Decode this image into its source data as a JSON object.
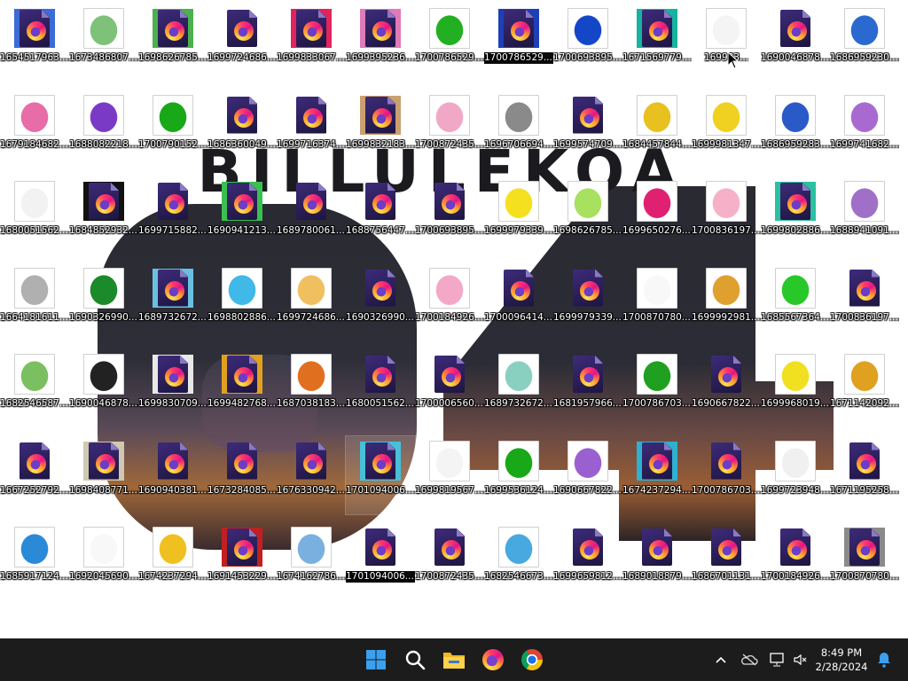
{
  "taskbar": {
    "start_label": "Start",
    "search_label": "Search",
    "pinned": [
      "File Explorer",
      "Firefox",
      "Google Chrome"
    ],
    "clock_time": "8:49 PM",
    "clock_date": "2/28/2024"
  },
  "wallpaper": {
    "title_text": "BILLULEKOA",
    "digits": "64"
  },
  "colors": {
    "taskbar_bg": "#1c1c1c",
    "desktop_bg": "#ffffff",
    "firefox_file": "#3d2b7a"
  },
  "icons": [
    {
      "label": "1654517963....",
      "type": "firefox-file",
      "thumb": "#3b6bd6"
    },
    {
      "label": "1673486807....",
      "type": "image",
      "thumb": "#7ec27a"
    },
    {
      "label": "1698626785....",
      "type": "firefox-file",
      "thumb": "#4caf50"
    },
    {
      "label": "1699724686....",
      "type": "firefox-file"
    },
    {
      "label": "1699833067....",
      "type": "firefox-file",
      "thumb": "#e0245e"
    },
    {
      "label": "1699395236....",
      "type": "firefox-file",
      "thumb": "#e07ab8"
    },
    {
      "label": "1700786529....",
      "type": "image",
      "thumb": "#22b022"
    },
    {
      "label": "1700786529....",
      "type": "firefox-file",
      "thumb": "#1e3fb8",
      "label_selected": true
    },
    {
      "label": "1700693895....",
      "type": "image",
      "thumb": "#1447c8"
    },
    {
      "label": "1671569779....",
      "type": "firefox-file",
      "thumb": "#18b3a0"
    },
    {
      "label": "169983...",
      "type": "image",
      "thumb": "#f4f4f4",
      "selected": true
    },
    {
      "label": "1690046878....",
      "type": "firefox-file"
    },
    {
      "label": "1686959230....",
      "type": "image",
      "thumb": "#2a6ad0"
    },
    {
      "label": "1679184682....",
      "type": "image",
      "thumb": "#e76ca8"
    },
    {
      "label": "1688082218....",
      "type": "image",
      "thumb": "#7a3ac6"
    },
    {
      "label": "1700790152....",
      "type": "image",
      "thumb": "#18a818"
    },
    {
      "label": "1686360049....",
      "type": "firefox-file"
    },
    {
      "label": "1699716374....",
      "type": "firefox-file"
    },
    {
      "label": "1699832183....",
      "type": "firefox-file",
      "thumb": "#c9a070"
    },
    {
      "label": "1700872435....",
      "type": "image",
      "thumb": "#f0a8c6"
    },
    {
      "label": "1696706694....",
      "type": "image",
      "thumb": "#8a8a8a"
    },
    {
      "label": "1699574709....",
      "type": "firefox-file"
    },
    {
      "label": "1684457844....",
      "type": "image",
      "thumb": "#e8c020"
    },
    {
      "label": "1699981347....",
      "type": "image",
      "thumb": "#f0d020"
    },
    {
      "label": "1686959283....",
      "type": "image",
      "thumb": "#2a5ac8"
    },
    {
      "label": "1699741682....",
      "type": "image",
      "thumb": "#a86ad0"
    },
    {
      "label": "1680051562....",
      "type": "image",
      "thumb": "#f2f2f2"
    },
    {
      "label": "1684852932....",
      "type": "firefox-file",
      "thumb": "#111111"
    },
    {
      "label": "1699715882....",
      "type": "firefox-file"
    },
    {
      "label": "1690941213....",
      "type": "firefox-file",
      "thumb": "#3ac050"
    },
    {
      "label": "1689780061....",
      "type": "firefox-file"
    },
    {
      "label": "1688756447....",
      "type": "firefox-file"
    },
    {
      "label": "1700693895....",
      "type": "firefox-file"
    },
    {
      "label": "1699979339....",
      "type": "image",
      "thumb": "#f5e020"
    },
    {
      "label": "1698626785....",
      "type": "image",
      "thumb": "#a8e060"
    },
    {
      "label": "1699650276....",
      "type": "image",
      "thumb": "#e02070"
    },
    {
      "label": "1700836197....",
      "type": "image",
      "thumb": "#f6b0c8"
    },
    {
      "label": "1699802886....",
      "type": "firefox-file",
      "thumb": "#2ac0a0"
    },
    {
      "label": "1688941091....",
      "type": "image",
      "thumb": "#a070c8"
    },
    {
      "label": "1664181611....",
      "type": "image",
      "thumb": "#b0b0b0"
    },
    {
      "label": "1690326990....",
      "type": "image",
      "thumb": "#1a8a2a"
    },
    {
      "label": "1689732672....",
      "type": "firefox-file",
      "thumb": "#6ac0e0"
    },
    {
      "label": "1698802886....",
      "type": "image",
      "thumb": "#40b8e8"
    },
    {
      "label": "1699724686....",
      "type": "image",
      "thumb": "#f0c060"
    },
    {
      "label": "1690326990....",
      "type": "firefox-file"
    },
    {
      "label": "1700184926....",
      "type": "image",
      "thumb": "#f4a8c8"
    },
    {
      "label": "1700096414....",
      "type": "firefox-file"
    },
    {
      "label": "1699979339....",
      "type": "firefox-file"
    },
    {
      "label": "1700870780....",
      "type": "image",
      "thumb": "#f8f8f8"
    },
    {
      "label": "1699992981....",
      "type": "image",
      "thumb": "#e0a030"
    },
    {
      "label": "1685567364....",
      "type": "image",
      "thumb": "#28c828"
    },
    {
      "label": "1700836197....",
      "type": "firefox-file"
    },
    {
      "label": "1682546587....",
      "type": "image",
      "thumb": "#7ac060"
    },
    {
      "label": "1690046878....",
      "type": "image",
      "thumb": "#222222"
    },
    {
      "label": "1699830709....",
      "type": "firefox-file",
      "thumb": "#e8e8e8"
    },
    {
      "label": "1699482768....",
      "type": "firefox-file",
      "thumb": "#e0a020"
    },
    {
      "label": "1687038183....",
      "type": "image",
      "thumb": "#e07020"
    },
    {
      "label": "1680051562....",
      "type": "firefox-file"
    },
    {
      "label": "1700006560....",
      "type": "firefox-file"
    },
    {
      "label": "1689732672....",
      "type": "image",
      "thumb": "#8ad0c0"
    },
    {
      "label": "1681957966....",
      "type": "firefox-file"
    },
    {
      "label": "1700786703....",
      "type": "image",
      "thumb": "#20a020"
    },
    {
      "label": "1690667822....",
      "type": "firefox-file"
    },
    {
      "label": "1699968019....",
      "type": "image",
      "thumb": "#f0e020"
    },
    {
      "label": "1671142092....",
      "type": "image",
      "thumb": "#e0a020"
    },
    {
      "label": "1667252792....",
      "type": "firefox-file"
    },
    {
      "label": "1698408771....",
      "type": "firefox-file",
      "thumb": "#d0c8b0"
    },
    {
      "label": "1690940381....",
      "type": "firefox-file"
    },
    {
      "label": "1673284085....",
      "type": "firefox-file"
    },
    {
      "label": "1676330942....",
      "type": "firefox-file"
    },
    {
      "label": "1701094006....",
      "type": "firefox-file",
      "thumb": "#48c0d8",
      "selected": true
    },
    {
      "label": "1699819567....",
      "type": "image",
      "thumb": "#f4f4f4"
    },
    {
      "label": "1699536124....",
      "type": "image",
      "thumb": "#18a818"
    },
    {
      "label": "1690667822....",
      "type": "image",
      "thumb": "#9a60d0"
    },
    {
      "label": "1674237294....",
      "type": "firefox-file",
      "thumb": "#30b0d0"
    },
    {
      "label": "1700786703....",
      "type": "firefox-file"
    },
    {
      "label": "1699723948....",
      "type": "image",
      "thumb": "#f0f0f0"
    },
    {
      "label": "1671195258....",
      "type": "firefox-file"
    },
    {
      "label": "1685917124....",
      "type": "image",
      "thumb": "#2a8ad8"
    },
    {
      "label": "1692045690....",
      "type": "image",
      "thumb": "#f8f8f8"
    },
    {
      "label": "1674237294....",
      "type": "image",
      "thumb": "#f0c020"
    },
    {
      "label": "1691453229....",
      "type": "firefox-file",
      "thumb": "#c02020"
    },
    {
      "label": "1674162786....",
      "type": "image",
      "thumb": "#7ab0e0"
    },
    {
      "label": "1701094006....",
      "type": "firefox-file",
      "label_selected": true
    },
    {
      "label": "1700872435....",
      "type": "firefox-file"
    },
    {
      "label": "1682546673....",
      "type": "image",
      "thumb": "#48a8e0"
    },
    {
      "label": "1699659812....",
      "type": "firefox-file"
    },
    {
      "label": "1689018879....",
      "type": "firefox-file"
    },
    {
      "label": "1686701131....",
      "type": "firefox-file"
    },
    {
      "label": "1700184926....",
      "type": "firefox-file"
    },
    {
      "label": "1700870780....",
      "type": "firefox-file",
      "thumb": "#8a8a8a"
    }
  ]
}
